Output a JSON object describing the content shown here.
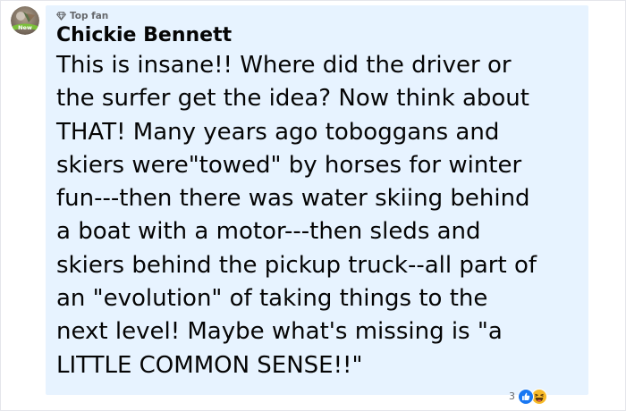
{
  "comment": {
    "avatar_badge": "New",
    "badge_icon": "diamond-icon",
    "badge_label": "Top fan",
    "author": "Chickie Bennett",
    "text": "This is insane!! Where did the driver or\nthe surfer get the idea? Now think about\nTHAT! Many years ago toboggans and\nskiers were\"towed\" by horses for winter\nfun---then there was water skiing behind\na boat with a motor---then sleds and\nskiers behind the pickup truck--all part of\nan \"evolution\" of taking things to the\nnext level! Maybe what's missing is \"a\nLITTLE COMMON SENSE!!\"",
    "reactions": {
      "count": "3",
      "icons": [
        "like-icon",
        "haha-icon"
      ]
    }
  },
  "colors": {
    "bubble_background": "#e7f3ff",
    "text": "#050505",
    "meta_text": "#65676b",
    "like_blue": "#1877f2",
    "haha_yellow": "#f7b928"
  }
}
